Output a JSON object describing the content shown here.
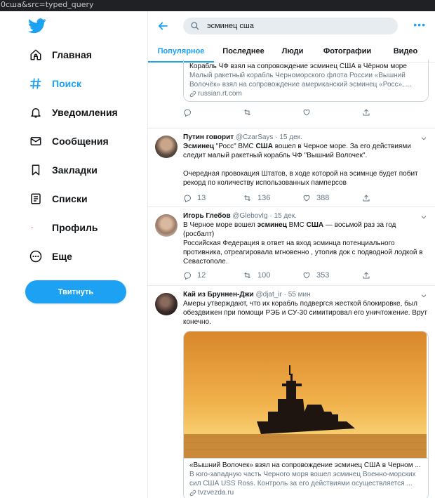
{
  "browser": {
    "url_fragment": "0сша&src=typed_query"
  },
  "sidebar": {
    "items": [
      {
        "label": "Главная"
      },
      {
        "label": "Поиск"
      },
      {
        "label": "Уведомления"
      },
      {
        "label": "Сообщения"
      },
      {
        "label": "Закладки"
      },
      {
        "label": "Списки"
      },
      {
        "label": "Профиль"
      },
      {
        "label": "Еще"
      }
    ],
    "tweet_button": "Твитнуть"
  },
  "colors": {
    "accent": "#1da1f2",
    "text": "#14171a",
    "muted": "#657786",
    "border": "#e6ecf0"
  },
  "header": {
    "search_value": "эсминец сша",
    "tabs": [
      "Популярное",
      "Последнее",
      "Люди",
      "Фотографии",
      "Видео"
    ]
  },
  "top_card": {
    "title_partial": "Корабль ЧФ взял на сопровождение эсминец США в Чёрном море",
    "desc": "Малый ракетный корабль Черноморского флота России «Вышний Волочёк» взял на сопровождение американский эсминец «Росс», ...",
    "domain": "russian.rt.com"
  },
  "tweets": [
    {
      "name": "Путин говорит",
      "handle": "@CzarSays",
      "time": "· 15 дек.",
      "text_parts": [
        "Эсминец",
        " \"Росс\" ВМС ",
        "США",
        " вошел в Черное море. За его действиями следит малый ракетный корабль ЧФ \"Вышний Волочек\"."
      ],
      "text2": "Очередная провокация Штатов, в ходе которой на эсимнце будет побит рекорд по количеству использованных памперсов",
      "replies": "13",
      "retweets": "136",
      "likes": "388"
    },
    {
      "name": "Игорь Глебов",
      "handle": "@GlebovIg",
      "time": "· 15 дек.",
      "text_parts": [
        "В Черное море вошел ",
        "эсминец",
        " ВМС ",
        "США",
        " — восьмой раз за год (росбалт)"
      ],
      "text2": "Российская Федерация в ответ на вход эсминца потенциального противника, отреагировала мгновенно , утопив док с подводной лодкой в Севастополе.",
      "replies": "12",
      "retweets": "100",
      "likes": "353"
    },
    {
      "name": "Кай из Бруннен-Джи",
      "handle": "@djat_ir",
      "time": "· 55 мин",
      "text": "Амеры утверждают, что их корабль подвергся жесткой блокировке, был обездвижен при помощи РЭБ и СУ-30 симитировал его уничтожение. Врут конечно.",
      "card_title": "«Вышний Волочек» взял на сопровождение эсминец США в Черном ...",
      "card_desc": "В юго-западную часть Черного моря вошел эсминец Военно-морских сил США USS Ross. Контроль за его действиями осуществляется ...",
      "card_domain": "tvzvezda.ru"
    }
  ]
}
